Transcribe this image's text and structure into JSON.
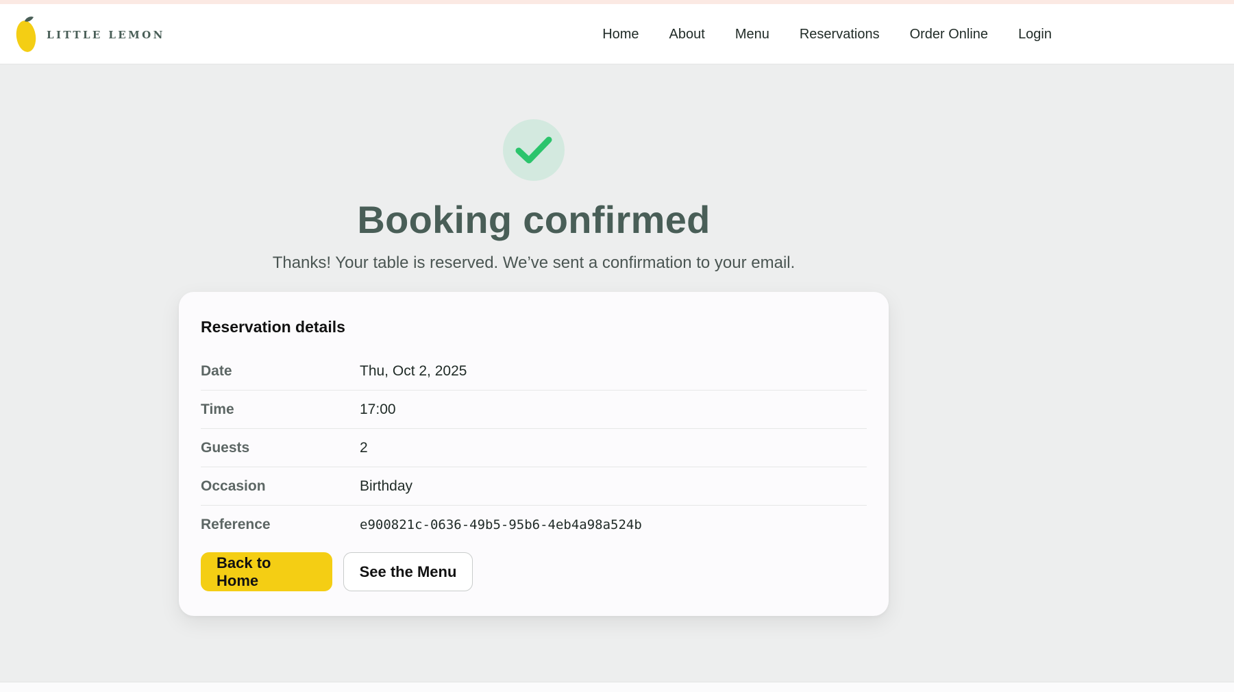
{
  "brand": {
    "name": "LITTLE LEMON",
    "accent": "#f4ce14",
    "primary": "#495e57"
  },
  "nav": {
    "items": [
      {
        "label": "Home"
      },
      {
        "label": "About"
      },
      {
        "label": "Menu"
      },
      {
        "label": "Reservations"
      },
      {
        "label": "Order Online"
      },
      {
        "label": "Login"
      }
    ]
  },
  "confirmation": {
    "icon": "check-icon",
    "title": "Booking confirmed",
    "message": "Thanks! Your table is reserved. We’ve sent a confirmation to your email."
  },
  "details": {
    "heading": "Reservation details",
    "rows": [
      {
        "label": "Date",
        "value": "Thu, Oct 2, 2025"
      },
      {
        "label": "Time",
        "value": "17:00"
      },
      {
        "label": "Guests",
        "value": "2"
      },
      {
        "label": "Occasion",
        "value": "Birthday"
      },
      {
        "label": "Reference",
        "value": "e900821c-0636-49b5-95b6-4eb4a98a524b"
      }
    ]
  },
  "actions": {
    "home_label": "Back to Home",
    "menu_label": "See the Menu"
  }
}
